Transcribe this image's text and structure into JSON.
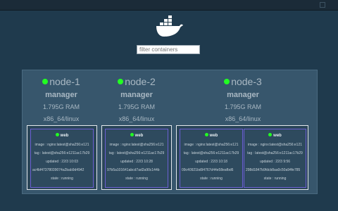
{
  "search": {
    "placeholder": "filter containers"
  },
  "nodes": [
    {
      "name": "node-1",
      "role": "manager",
      "ram": "1.795G RAM",
      "arch": "x86_64/linux"
    },
    {
      "name": "node-2",
      "role": "manager",
      "ram": "1.795G RAM",
      "arch": "x86_64/linux"
    },
    {
      "name": "node-3",
      "role": "manager",
      "ram": "1.795G RAM",
      "arch": "x86_64/linux"
    }
  ],
  "tasks": [
    {
      "name": "web",
      "image": "image : nginx:latest@sha256:e121",
      "tag": "tag : latest@sha256:e1211ac17b29",
      "updated": "updated : 22/3 10:03",
      "id": "ac4bf47378039074a2bab9d4942",
      "state": "state : running"
    },
    {
      "name": "web",
      "image": "image : nginx:latest@sha256:e121",
      "tag": "tag : latest@sha256:e1211ac17b29",
      "updated": "updated : 22/3 10:28",
      "id": "97b5a101641abcd7ad2a90c144b",
      "state": "state : running"
    },
    {
      "name": "web",
      "image": "image : nginx:latest@sha256:e121",
      "tag": "tag : latest@sha256:e1211ac17b29",
      "updated": "updated : 22/3 10:18",
      "id": "09c40921bd94767d44e58eafbd6",
      "state": "state : running"
    },
    {
      "name": "web",
      "image": "image : nginx:latest@sha256:e121",
      "tag": "tag : latest@sha256:e1211ac17b29",
      "updated": "updated : 22/3 9:56",
      "id": "298d1847b9fdcb8aa0c50a94fe785",
      "state": "state : running"
    }
  ],
  "colors": {
    "online": "#22ff22",
    "task_border": "#6b5fd3",
    "background": "#1f3a4d"
  },
  "icons": {
    "logo": "docker-whale-icon"
  }
}
